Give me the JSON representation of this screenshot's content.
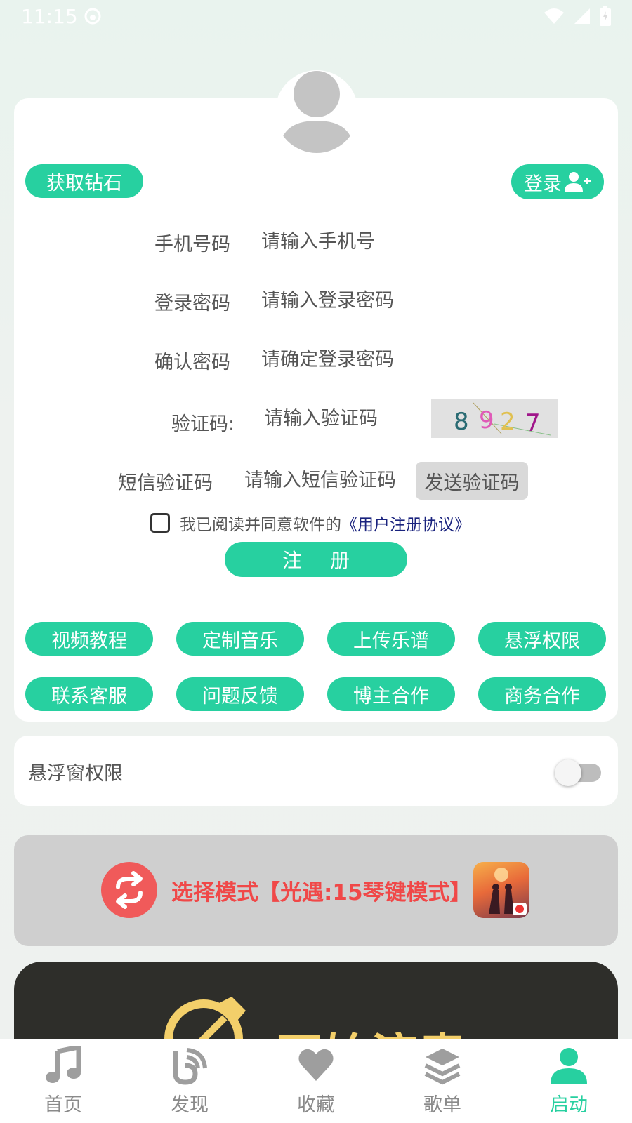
{
  "status_bar": {
    "time": "11:15"
  },
  "account": {
    "get_diamond_label": "获取钻石",
    "login_label": "登录"
  },
  "form": {
    "phone": {
      "label": "手机号码",
      "placeholder": "请输入手机号"
    },
    "password": {
      "label": "登录密码",
      "placeholder": "请输入登录密码"
    },
    "confirm": {
      "label": "确认密码",
      "placeholder": "请确定登录密码"
    },
    "captcha": {
      "label": "验证码:",
      "placeholder": "请输入验证码",
      "code": [
        "8",
        "9",
        "2",
        "7"
      ]
    },
    "sms": {
      "label": "短信验证码",
      "placeholder": "请输入短信验证码",
      "send_label": "发送验证码"
    },
    "agree_text": "我已阅读并同意软件的",
    "agree_link": "《用户注册协议》",
    "register_label": "注册"
  },
  "actions": [
    "视频教程",
    "定制音乐",
    "上传乐谱",
    "悬浮权限",
    "联系客服",
    "问题反馈",
    "博主合作",
    "商务合作"
  ],
  "float_permission": {
    "label": "悬浮窗权限",
    "enabled": false
  },
  "mode": {
    "text": "选择模式【光遇:15琴键模式】"
  },
  "start": {
    "text": "开始演奏"
  },
  "nav": {
    "items": [
      {
        "label": "首页",
        "icon": "music-note-icon"
      },
      {
        "label": "发现",
        "icon": "discover-icon"
      },
      {
        "label": "收藏",
        "icon": "heart-icon"
      },
      {
        "label": "歌单",
        "icon": "layers-icon"
      },
      {
        "label": "启动",
        "icon": "user-icon"
      }
    ],
    "active_index": 4
  },
  "colors": {
    "accent": "#27d0a0",
    "mode_red": "#f04848",
    "link_blue": "#1a237e"
  }
}
